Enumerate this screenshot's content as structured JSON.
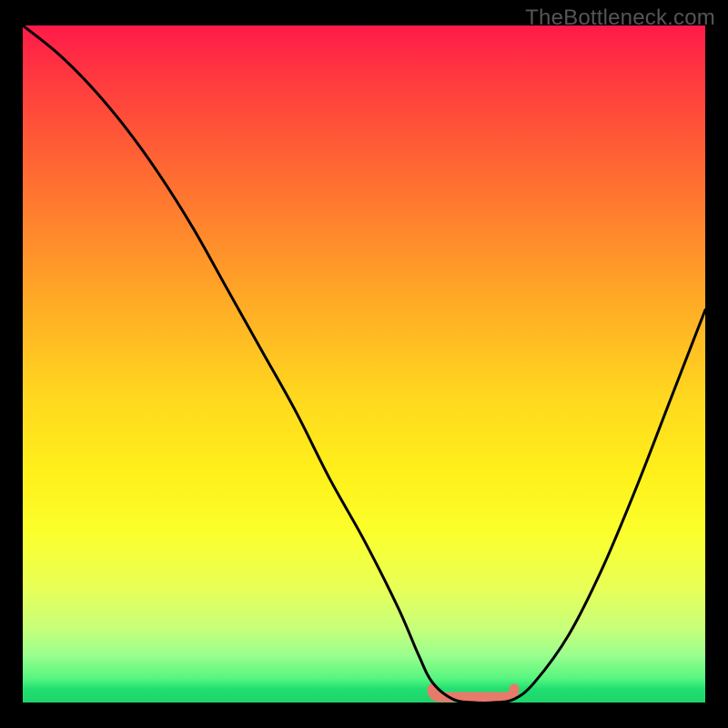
{
  "watermark": "TheBottleneck.com",
  "colors": {
    "frame": "#000000",
    "gradient_top": "#ff1a49",
    "gradient_mid": "#ffe41c",
    "gradient_bottom": "#1ed36a",
    "curve": "#000000",
    "marker": "#e77a6a"
  },
  "chart_data": {
    "type": "line",
    "title": "",
    "xlabel": "",
    "ylabel": "",
    "xlim": [
      0,
      100
    ],
    "ylim": [
      0,
      100
    ],
    "grid": false,
    "annotations": [
      "TheBottleneck.com"
    ],
    "series": [
      {
        "name": "bottleneck-curve",
        "x": [
          0,
          5,
          10,
          15,
          20,
          25,
          30,
          35,
          40,
          45,
          50,
          55,
          58,
          60,
          63,
          66,
          69,
          72,
          75,
          80,
          85,
          90,
          95,
          100
        ],
        "y": [
          100,
          96,
          91,
          85,
          78,
          70,
          61,
          52,
          43,
          33,
          24,
          14,
          7,
          3,
          0.5,
          0,
          0,
          0.5,
          3,
          10,
          20,
          32,
          45,
          58
        ]
      },
      {
        "name": "optimal-range-marker",
        "x": [
          60,
          72
        ],
        "y": [
          0,
          0
        ]
      }
    ]
  }
}
